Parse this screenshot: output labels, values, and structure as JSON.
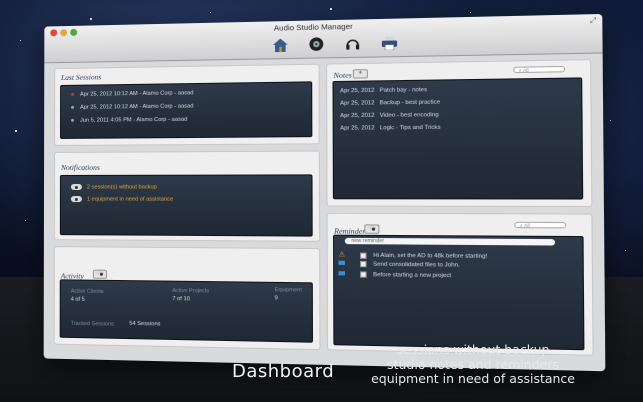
{
  "window": {
    "title": "Audio Studio Manager"
  },
  "toolbar": {
    "icons": [
      "home-icon",
      "record-icon",
      "headphones-icon",
      "printer-icon"
    ]
  },
  "last_sessions": {
    "title": "Last Sessions",
    "rows": [
      "Apr 25, 2012 10:12 AM - Alamo Corp - aasad",
      "Apr 25, 2012 10:12 AM - Alamo Corp - aasad",
      "Jun 5, 2011 4:05 PM - Alamo Corp - aasad"
    ]
  },
  "notifications": {
    "title": "Notifications",
    "rows": [
      "2 session(s) without backup",
      "1 equipment in need of assistance"
    ]
  },
  "activity": {
    "title": "Activity",
    "active_clients_label": "Active Clients",
    "active_clients_value": "4 of 5",
    "active_projects_label": "Active Projects",
    "active_projects_value": "7 of 10",
    "equipment_label": "Equipment",
    "equipment_value": "9",
    "tracked_label": "Tracked Sessions:",
    "tracked_value": "54 Sessions"
  },
  "notes": {
    "title": "Notes",
    "add_label": "+",
    "search_placeholder": "All",
    "rows": [
      {
        "date": "Apr 25, 2012",
        "text": "Patch bay - notes"
      },
      {
        "date": "Apr 25, 2012",
        "text": "Backup - best practice"
      },
      {
        "date": "Apr 25, 2012",
        "text": "Video - best encoding"
      },
      {
        "date": "Apr 25, 2012",
        "text": "Logic - Tips and Tricks"
      }
    ]
  },
  "reminder": {
    "title": "Reminder",
    "search_placeholder": "All",
    "new_placeholder": "new reminder",
    "rows": [
      "Hi Alain, set the AD to 48k before starting!",
      "Send consolidated files to John.",
      "Before starting a new project"
    ]
  },
  "caption": "Dashboard",
  "tagline": [
    "sessions without backup",
    "studio notes and reminders",
    "equipment in need of assistance"
  ],
  "colors": {
    "accent_orange": "#e6a23c",
    "panel_dark": "#2e3a4a"
  }
}
